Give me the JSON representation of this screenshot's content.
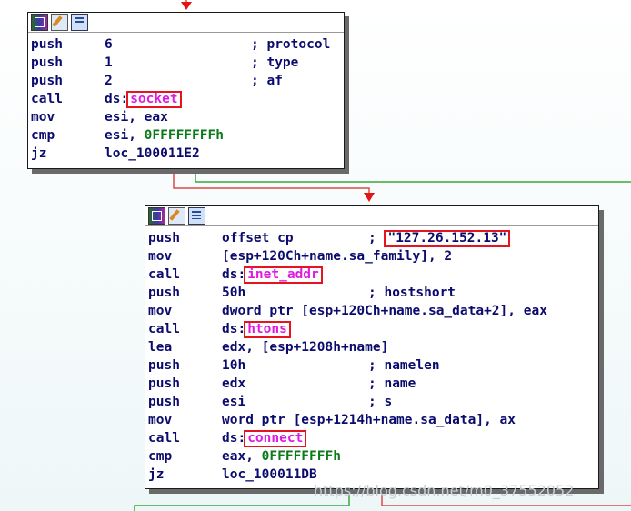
{
  "block1": {
    "rows": [
      {
        "mn": "push",
        "op": "6",
        "cm": "; protocol"
      },
      {
        "mn": "push",
        "op": "1",
        "cm": "; type"
      },
      {
        "mn": "push",
        "op": "2",
        "cm": "; af"
      },
      {
        "mn": "call",
        "pre": "ds:",
        "fn": "socket"
      },
      {
        "mn": "mov",
        "op": "esi, eax"
      },
      {
        "mn": "cmp",
        "pre": "esi, ",
        "num": "0FFFFFFFFh"
      },
      {
        "mn": "jz",
        "op": "loc_100011E2"
      }
    ]
  },
  "block2": {
    "rows": [
      {
        "mn": "push",
        "op": "offset cp",
        "cm": "; ",
        "str": "\"127.26.152.13\""
      },
      {
        "mn": "mov",
        "op": "[esp+120Ch+name.sa_family], 2"
      },
      {
        "mn": "call",
        "pre": "ds:",
        "fn": "inet_addr"
      },
      {
        "mn": "push",
        "op": "50h",
        "cm": "; hostshort"
      },
      {
        "mn": "mov",
        "op": "dword ptr [esp+120Ch+name.sa_data+2], eax"
      },
      {
        "mn": "call",
        "pre": "ds:",
        "fn": "htons"
      },
      {
        "mn": "lea",
        "op": "edx, [esp+1208h+name]"
      },
      {
        "mn": "push",
        "op": "10h",
        "cm": "; namelen"
      },
      {
        "mn": "push",
        "op": "edx",
        "cm": "; name"
      },
      {
        "mn": "push",
        "op": "esi",
        "cm": "; s"
      },
      {
        "mn": "mov",
        "op": "word ptr [esp+1214h+name.sa_data], ax"
      },
      {
        "mn": "call",
        "pre": "ds:",
        "fn": "connect"
      },
      {
        "mn": "cmp",
        "pre": "eax, ",
        "num": "0FFFFFFFFh"
      },
      {
        "mn": "jz",
        "op": "loc_100011DB"
      }
    ]
  },
  "watermark": "https://blog.csdn.net/m0_37552052",
  "colors": {
    "flow_true": "#3aa83a",
    "flow_false": "#e04a4a",
    "highlight_box": "#e5141e",
    "import_name": "#e01ae0"
  }
}
